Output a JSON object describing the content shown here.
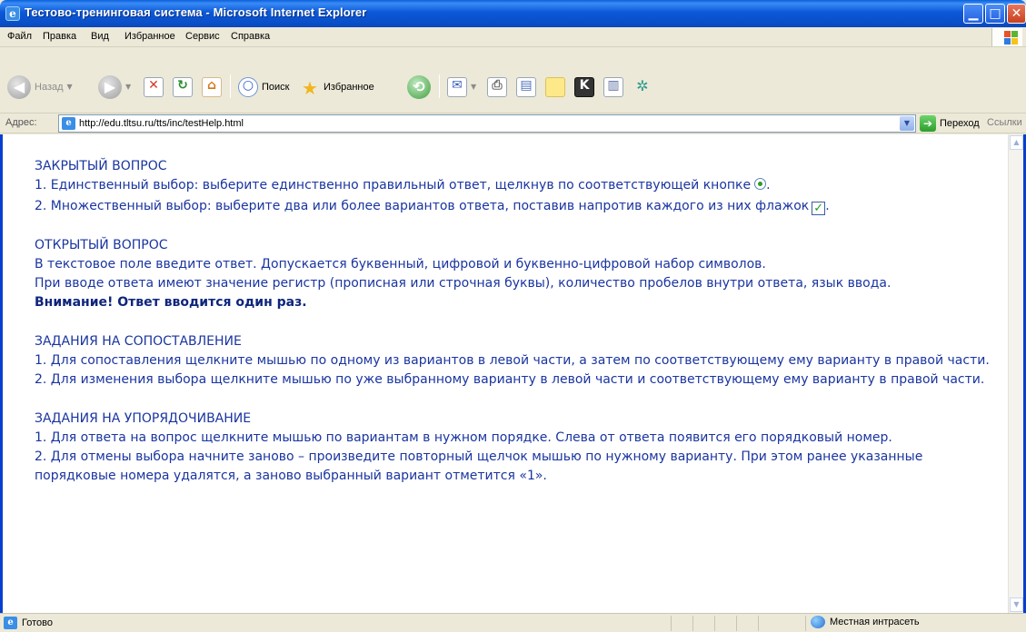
{
  "window": {
    "title": "Тестово-тренинговая система - Microsoft Internet Explorer",
    "min_glyph": "▁",
    "max_glyph": "□",
    "close_glyph": "✕"
  },
  "menu": [
    "Файл",
    "Правка",
    "Вид",
    "Избранное",
    "Сервис",
    "Справка"
  ],
  "toolbar": {
    "back_label": "Назад",
    "search_label": "Поиск",
    "favorites_label": "Избранное"
  },
  "address": {
    "label": "Адрес:",
    "url": "http://edu.tltsu.ru/tts/inc/testHelp.html",
    "go_label": "Переход",
    "links_label": "Ссылки"
  },
  "sections": [
    {
      "heading": "ЗАКРЫТЫЙ ВОПРОС",
      "lines": [
        "1. Единственный выбор: выберите единственно правильный ответ, щелкнув по соответствующей кнопке",
        "2. Множественный выбор: выберите два или более вариантов ответа, поставив напротив каждого из них флажок"
      ]
    },
    {
      "heading": "ОТКРЫТЫЙ ВОПРОС",
      "lines": [
        "В текстовое поле введите ответ. Допускается буквенный, цифровой и буквенно-цифровой набор символов.",
        "При вводе ответа имеют значение регистр (прописная или строчная буквы), количество пробелов внутри ответа, язык ввода."
      ],
      "warning": "Внимание! Ответ вводится один раз."
    },
    {
      "heading": "ЗАДАНИЯ НА СОПОСТАВЛЕНИЕ",
      "lines": [
        "1. Для сопоставления щелкните мышью по одному из вариантов в левой части, а затем по соответствующему ему варианту в правой части.",
        "2. Для изменения выбора щелкните мышью по уже выбранному варианту в левой части и соответствующему ему варианту в правой части."
      ]
    },
    {
      "heading": "ЗАДАНИЯ НА УПОРЯДОЧИВАНИЕ",
      "lines": [
        "1. Для ответа на вопрос щелкните мышью по вариантам в нужном порядке. Слева от ответа появится его порядковый номер.",
        "2. Для отмены выбора начните заново – произведите повторный щелчок мышью по нужному варианту. При этом ранее указанные порядковые номера удалятся, а заново выбранный вариант отметится «1»."
      ]
    }
  ],
  "punctuation": {
    "period": "."
  },
  "status": {
    "text": "Готово",
    "zone": "Местная интрасеть"
  }
}
